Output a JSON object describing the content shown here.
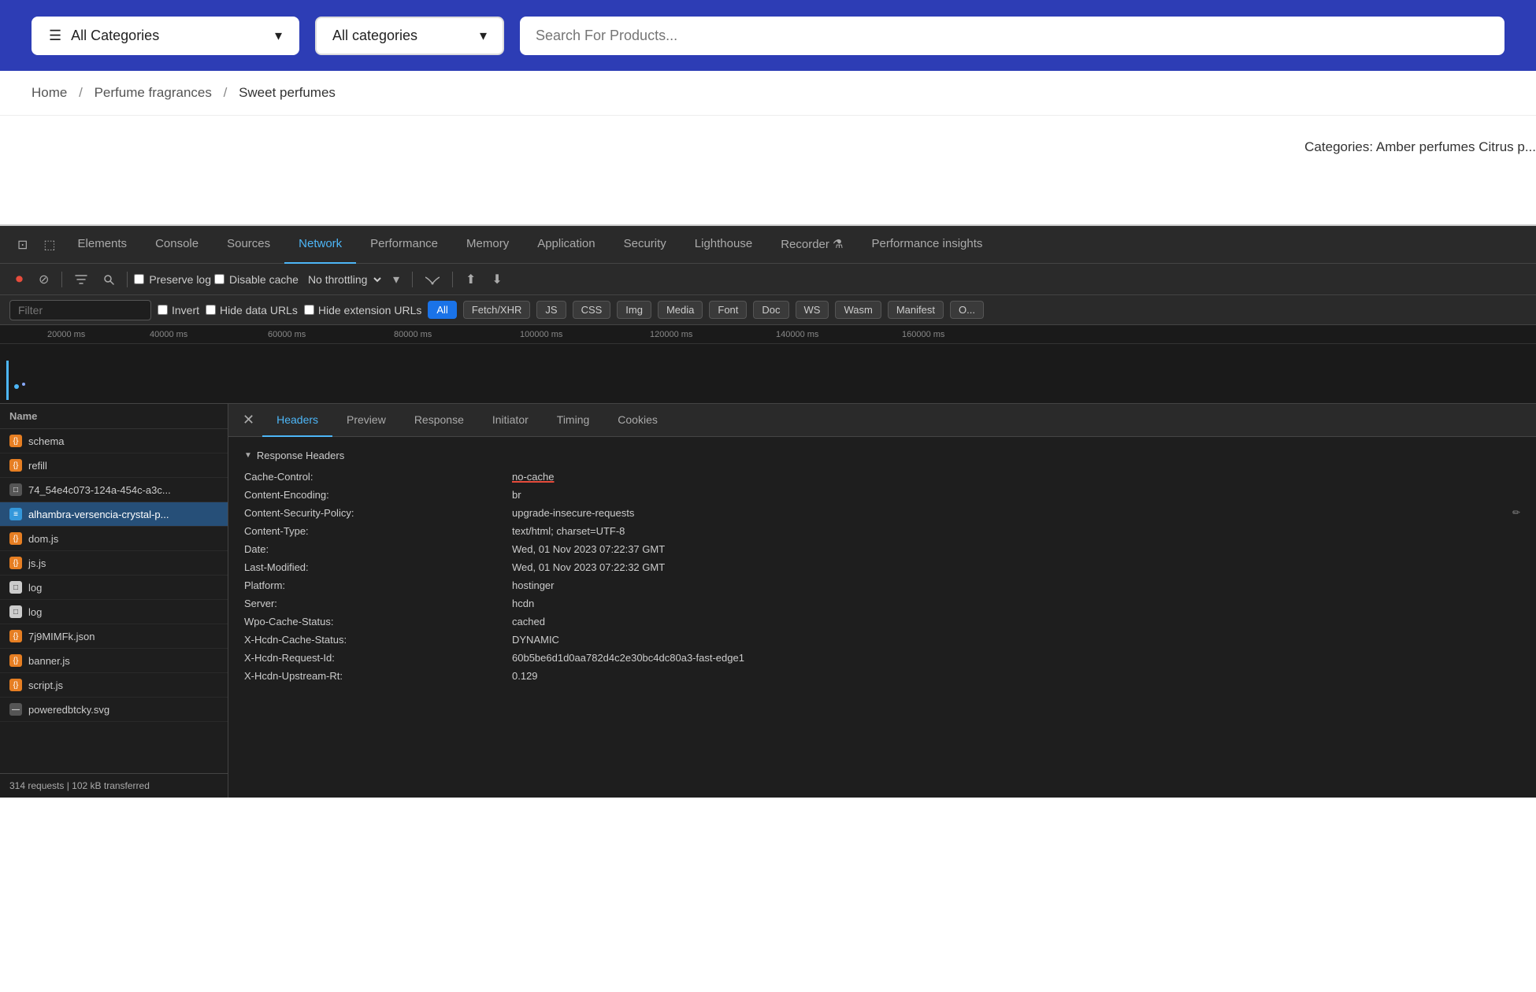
{
  "topNav": {
    "categoriesLabel": "All Categories",
    "dropdownLabel": "All categories",
    "searchPlaceholder": "Search For Products..."
  },
  "breadcrumb": {
    "home": "Home",
    "sep1": "/",
    "perfume": "Perfume fragrances",
    "sep2": "/",
    "current": "Sweet perfumes"
  },
  "pageContent": {
    "categories_label": "Categories: Amber perfumes  Citrus p..."
  },
  "devtools": {
    "tabs": [
      {
        "label": "Elements",
        "id": "elements"
      },
      {
        "label": "Console",
        "id": "console"
      },
      {
        "label": "Sources",
        "id": "sources"
      },
      {
        "label": "Network",
        "id": "network",
        "active": true
      },
      {
        "label": "Performance",
        "id": "performance"
      },
      {
        "label": "Memory",
        "id": "memory"
      },
      {
        "label": "Application",
        "id": "application"
      },
      {
        "label": "Security",
        "id": "security"
      },
      {
        "label": "Lighthouse",
        "id": "lighthouse"
      },
      {
        "label": "Recorder ⚗",
        "id": "recorder"
      },
      {
        "label": "Performance insights",
        "id": "perf-insights"
      }
    ],
    "toolbar": {
      "preserve_log": "Preserve log",
      "disable_cache": "Disable cache",
      "throttle": "No throttling"
    },
    "filter": {
      "placeholder": "Filter",
      "invert": "Invert",
      "hide_data_urls": "Hide data URLs",
      "hide_extension_urls": "Hide extension URLs",
      "tags": [
        "All",
        "Fetch/XHR",
        "JS",
        "CSS",
        "Img",
        "Media",
        "Font",
        "Doc",
        "WS",
        "Wasm",
        "Manifest",
        "O..."
      ]
    },
    "timeline": {
      "marks": [
        "20000 ms",
        "40000 ms",
        "60000 ms",
        "80000 ms",
        "100000 ms",
        "120000 ms",
        "140000 ms",
        "160000 ms"
      ]
    },
    "nameList": {
      "header": "Name",
      "items": [
        {
          "icon": "orange",
          "name": "schema",
          "type": "js"
        },
        {
          "icon": "orange",
          "name": "refill",
          "type": "js"
        },
        {
          "icon": "gray",
          "name": "74_54e4c073-124a-454c-a3c...",
          "type": "doc"
        },
        {
          "icon": "blue",
          "name": "alhambra-versencia-crystal-p...",
          "type": "doc",
          "active": true
        },
        {
          "icon": "orange",
          "name": "dom.js",
          "type": "js"
        },
        {
          "icon": "orange",
          "name": "js.js",
          "type": "js"
        },
        {
          "icon": "white",
          "name": "log",
          "type": "blank"
        },
        {
          "icon": "white",
          "name": "log",
          "type": "blank"
        },
        {
          "icon": "orange",
          "name": "7j9MIMFk.json",
          "type": "json"
        },
        {
          "icon": "orange",
          "name": "banner.js",
          "type": "js"
        },
        {
          "icon": "orange",
          "name": "script.js",
          "type": "js"
        },
        {
          "icon": "gray",
          "name": "poweredbtcky.svg",
          "type": "svg"
        }
      ],
      "footer": "314 requests  |  102 kB transferred"
    },
    "details": {
      "tabs": [
        "Headers",
        "Preview",
        "Response",
        "Initiator",
        "Timing",
        "Cookies"
      ],
      "activeTab": "Headers",
      "sectionTitle": "Response Headers",
      "headers": [
        {
          "name": "Cache-Control:",
          "value": "no-cache",
          "underline": true
        },
        {
          "name": "Content-Encoding:",
          "value": "br"
        },
        {
          "name": "Content-Security-Policy:",
          "value": "upgrade-insecure-requests",
          "edit": true
        },
        {
          "name": "Content-Type:",
          "value": "text/html; charset=UTF-8"
        },
        {
          "name": "Date:",
          "value": "Wed, 01 Nov 2023 07:22:37 GMT"
        },
        {
          "name": "Last-Modified:",
          "value": "Wed, 01 Nov 2023 07:22:32 GMT"
        },
        {
          "name": "Platform:",
          "value": "hostinger"
        },
        {
          "name": "Server:",
          "value": "hcdn"
        },
        {
          "name": "Wpo-Cache-Status:",
          "value": "cached"
        },
        {
          "name": "X-Hcdn-Cache-Status:",
          "value": "DYNAMIC"
        },
        {
          "name": "X-Hcdn-Request-Id:",
          "value": "60b5be6d1d0aa782d4c2e30bc4dc80a3-fast-edge1"
        },
        {
          "name": "X-Hcdn-Upstream-Rt:",
          "value": "0.129"
        }
      ]
    }
  }
}
